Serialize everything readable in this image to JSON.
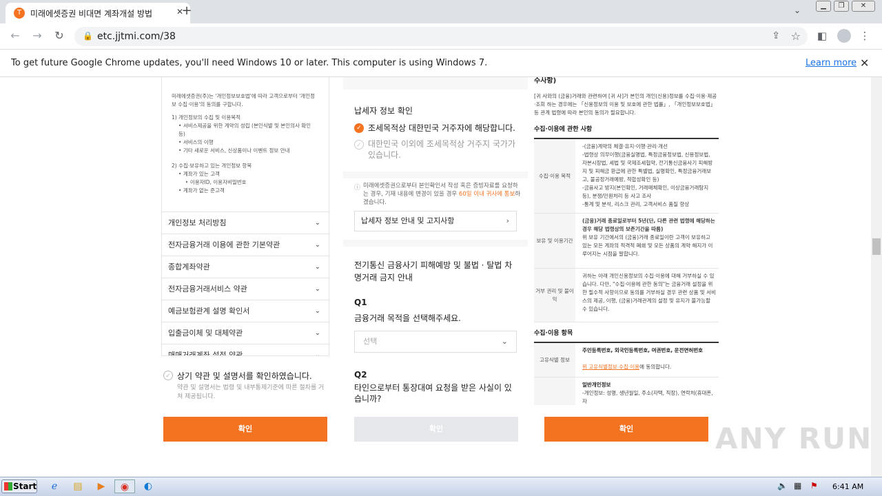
{
  "browser": {
    "tab_title": "미래에셋증권 비대면 계좌개설 방법",
    "tab_favicon": "T",
    "tab_close": "✕",
    "new_tab": "+",
    "url": "etc.jjtmi.com/38",
    "infobar_message": "To get future Google Chrome updates, you'll need Windows 10 or later. This computer is using Windows 7.",
    "infobar_link": "Learn more",
    "infobar_close": "✕"
  },
  "left_panel": {
    "intro": "미래에셋증권(주)는 '개인정보보호법'에 따라 고객으로부터 '개인정보 수집·이용'의 동의를 구합니다.",
    "section1_title": "1) 개인정보의 수집 및 이용목적",
    "section1_items": [
      "서비스제공을 위한 계약의 성립 (본인식별 및 본인의사 확인 등)",
      "서비스의 이행",
      "기타 새로운 서비스, 신상품이나 이벤트 정보 안내"
    ],
    "section2_title": "2) 수집·보유하고 있는 개인정보 항목",
    "section2_items": [
      "계좌가 있는 고객",
      "이용자ID, 이용자비밀번호",
      "계좌가 없는 준고객"
    ],
    "accordion": [
      "개인정보 처리방침",
      "전자금융거래 이용에 관한 기본약관",
      "종합계좌약관",
      "전자금융거래서비스 약관",
      "예금보험관계 설명 확인서",
      "입출금이체 및 대체약관",
      "매매거래계좌 설정 약관"
    ],
    "confirm_text": "상기 약관 및 설명서를 확인하였습니다.",
    "confirm_sub": "약관 및 설명서는 법령 및 내부통제기준에 따른 절차를 거쳐 제공됩니다.",
    "button": "확인"
  },
  "middle_panel": {
    "tax_title": "납세자 정보 확인",
    "option1": "조세목적상 대한민국 거주자에 해당합니다.",
    "option2": "대한민국 이외에 조세목적상 거주지 국가가 있습니다.",
    "notice_a": "미래에셋증권으로부터 본인확인서 작성 혹은 증빙자료를 요청하는 경우, 기재 내용에 변경이 있을 경우 ",
    "notice_highlight": "60일 이내 귀사에 통보",
    "notice_b": "하겠습니다.",
    "info_link": "납세자 정보 안내 및 고지사항",
    "fraud_title": "전기통신 금융사기 피해예방 및 불법 · 탈법 차명거래 금지 안내",
    "q1_label": "Q1",
    "q1_text": "금융거래 목적을 선택해주세요.",
    "q1_placeholder": "선택",
    "q2_label": "Q2",
    "q2_text": "타인으로부터 통장대여 요청을 받은 사실이 있습니까?",
    "button": "확인"
  },
  "right_panel": {
    "top_heading": "수사항)",
    "intro": "[귀 사와의 (금융)거래와 관련하여 [귀 사]가 본인의 개인(신용)정보를 수집·이용·제공·조회 하는 경우에는 「신용정보의 이용 및 보호에 관한 법률」, 「개인정보보호법」 등 관계 법령에 따라 본인의 동의가 필요합니다.",
    "section_use": "수집·이용에 관한 사항",
    "rows": [
      {
        "label": "수집·이용 목적",
        "value": "-(금융)계약의 체결·유지·이행·관리·개선\n-법령상 의무이행(금융실명법, 특정금융정보법, 신용정보법, 자본시장법, 세법 및 국제조세협약, 전기통신금융사기 피해방지 및 피해금 환급에 관한 특별법, 실명확인, 특정금융거래보고, 불공정거래예방, 적합성확인 등)\n-금융사고 방지(본인확인, 거래매체확인, 이상금융거래탐지 등), 분쟁/민원처리 등 사고 조사\n-통계 및 분석, 리스크 관리, 고객서비스 품질 향상"
      },
      {
        "label": "보유 및 이용기간",
        "value_bold": "(금융)거래 종료일로부터 5년(단, 다른 관련 법령에 해당하는 경우 해당 법령상의 보존기간을 따름)",
        "value": "위 보유 기간에서의 (금융)거래 종료일이란 고객이 보유하고 있는 모든 계좌의 적격적 폐쇄 및 모든 상품의 계약 해지가 이루어지는 시점을 말합니다."
      },
      {
        "label": "거부 권리 및 불이익",
        "value": "귀하는 아래 개인신용정보의 수집·이용에 대해 거부하실 수 있습니다. 다만, \"수집·이용에 관한 동의\"는 금융거래 설정을 위한 필수적 사항이므로 동의를 거부하실 경우 관련 상품 및 서비스의 제공, 이행, (금융)거래관계의 설정 및 유지가 불가능할 수 있습니다."
      }
    ],
    "section_items": "수집·이용 항목",
    "items_row_label": "고유식별 정보",
    "items_row_bold": "주민등록번호, 외국인등록번호, 여권번호, 운전면허번호",
    "items_row_link": "위 고유식별정보 수집·이용",
    "items_row_link_suffix": "에 동의합니다.",
    "general_bold": "일반개인정보",
    "general_text": "-개인정보: 성명, 생년월일, 주소(자택, 직장), 연락처(휴대폰, 자",
    "button": "확인"
  },
  "taskbar": {
    "start": "Start",
    "clock": "6:41 AM"
  },
  "watermark": "ANY RUN",
  "colors": {
    "accent": "#f37321",
    "disabled_btn": "#e5e7ea"
  }
}
